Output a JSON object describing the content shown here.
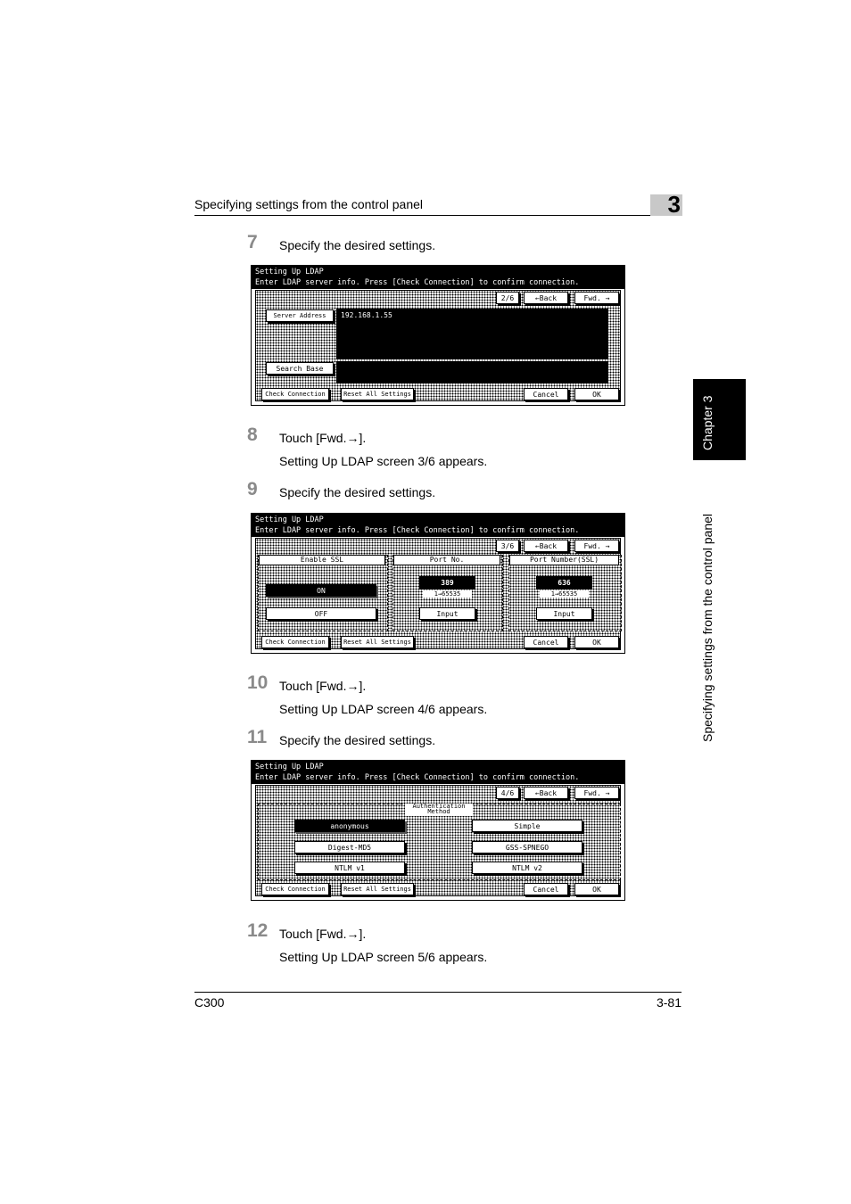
{
  "header": {
    "title": "Specifying settings from the control panel",
    "chapter_number": "3"
  },
  "side_tab": {
    "chapter_label": "Chapter 3",
    "section_label": "Specifying settings from the control panel"
  },
  "steps": [
    {
      "num": "7",
      "text": "Specify the desired settings."
    },
    {
      "num": "8",
      "text": "Touch [Fwd.→].",
      "sub": "Setting Up LDAP screen 3/6 appears."
    },
    {
      "num": "9",
      "text": "Specify the desired settings."
    },
    {
      "num": "10",
      "text": "Touch [Fwd.→].",
      "sub": "Setting Up LDAP screen 4/6 appears."
    },
    {
      "num": "11",
      "text": "Specify the desired settings."
    },
    {
      "num": "12",
      "text": "Touch [Fwd.→].",
      "sub": "Setting Up LDAP screen 5/6 appears."
    }
  ],
  "common": {
    "title": "Setting Up LDAP",
    "instruction": "Enter LDAP server info. Press [Check Connection] to confirm connection.",
    "back": "←Back",
    "fwd": "Fwd. →",
    "check_connection": "Check Connection",
    "reset_all": "Reset All Settings",
    "cancel": "Cancel",
    "ok": "OK"
  },
  "screen1": {
    "page": "2/6",
    "server_address_label": "Server Address",
    "server_address_value": "192.168.1.55",
    "search_base_label": "Search Base"
  },
  "screen2": {
    "page": "3/6",
    "enable_ssl_label": "Enable SSL",
    "on": "ON",
    "off": "OFF",
    "port_label": "Port No.",
    "port_value": "389",
    "port_range": "1→65535",
    "port_ssl_label": "Port Number(SSL)",
    "port_ssl_value": "636",
    "port_ssl_range": "1→65535",
    "input": "Input"
  },
  "screen3": {
    "page": "4/6",
    "auth_label": "Authentication Method",
    "options": [
      "anonymous",
      "Simple",
      "Digest-MD5",
      "GSS-SPNEGO",
      "NTLM v1",
      "NTLM v2"
    ]
  },
  "footer": {
    "model": "C300",
    "page": "3-81"
  }
}
